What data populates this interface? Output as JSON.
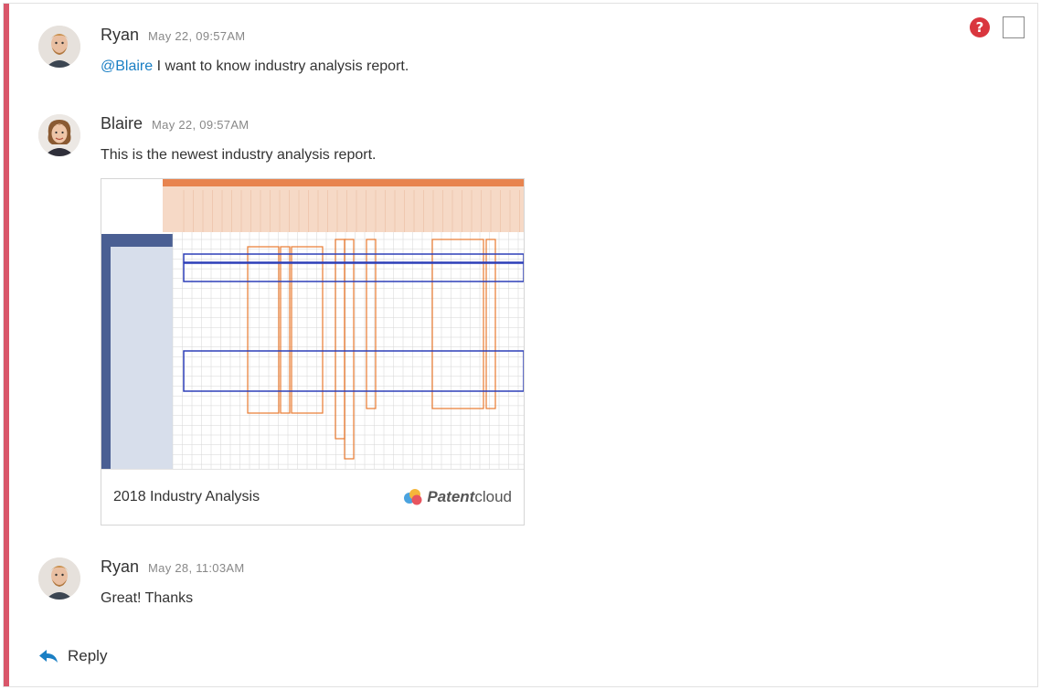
{
  "header": {
    "help_icon": "question-circle-icon",
    "help_glyph": "?",
    "select_checkbox": "checkbox-icon"
  },
  "messages": [
    {
      "author": "Ryan",
      "timestamp": "May 22, 09:57AM",
      "mention": "@Blaire",
      "text": " I want to know industry analysis report."
    },
    {
      "author": "Blaire",
      "timestamp": "May 22, 09:57AM",
      "text": "This is the newest industry analysis report.",
      "attachment": {
        "title": "2018 Industry Analysis",
        "brand": "Patentcloud",
        "brand_bold": "Patent",
        "brand_light": "cloud"
      }
    },
    {
      "author": "Ryan",
      "timestamp": "May 28, 11:03AM",
      "text": "Great! Thanks"
    }
  ],
  "reply": {
    "label": "Reply",
    "icon": "reply-arrow-icon"
  },
  "colors": {
    "accent": "#d9566a",
    "mention": "#1a7fc4",
    "help": "#d9363e",
    "table_header": "#e8844f",
    "table_side": "#4a5f93",
    "highlight_orange": "#e87a30",
    "highlight_blue": "#2d3fb8"
  }
}
